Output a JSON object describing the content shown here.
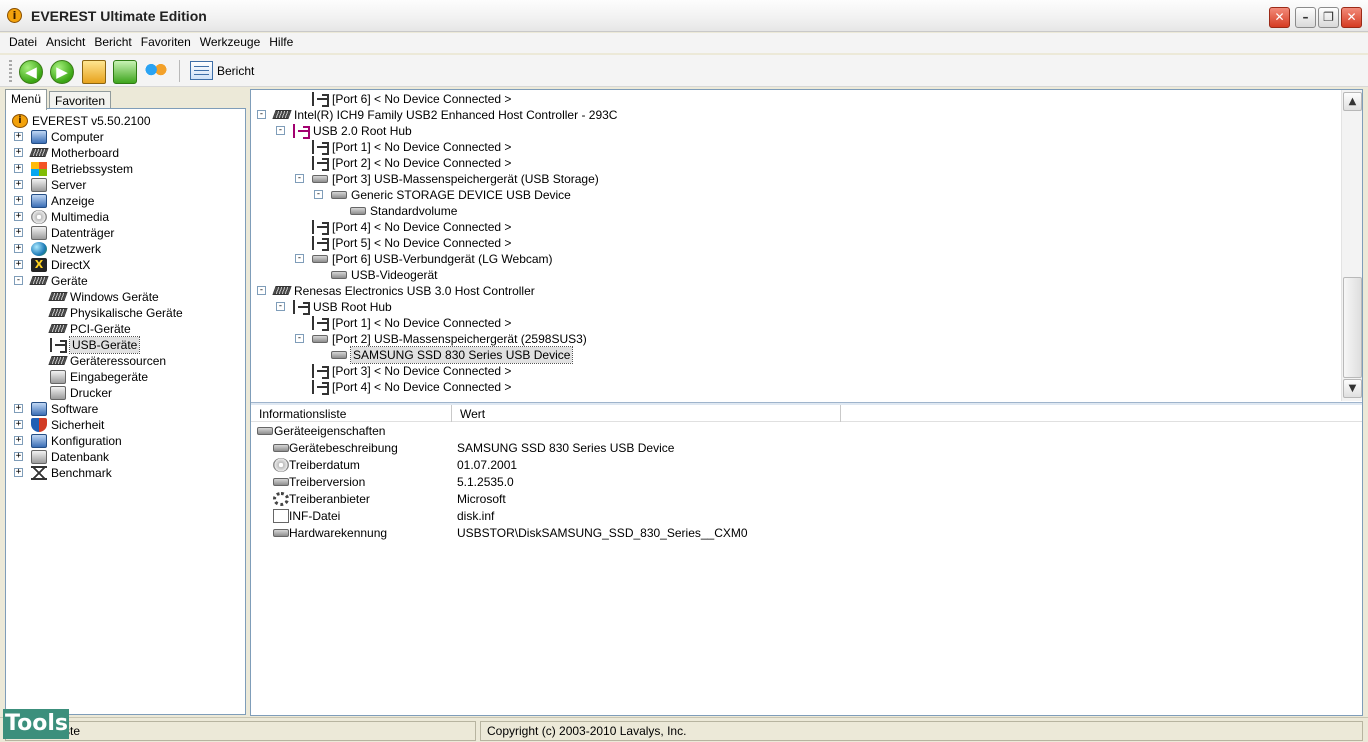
{
  "window": {
    "title": "EVEREST Ultimate Edition"
  },
  "menu": [
    "Datei",
    "Ansicht",
    "Bericht",
    "Favoriten",
    "Werkzeuge",
    "Hilfe"
  ],
  "toolbar": {
    "report_label": "Bericht"
  },
  "tabs": [
    "Menü",
    "Favoriten"
  ],
  "nav_tree": [
    {
      "label": "EVEREST v5.50.2100",
      "icon": "everest-icon",
      "level": 0
    },
    {
      "label": "Computer",
      "icon": "computer-icon",
      "level": 1,
      "expander": "+"
    },
    {
      "label": "Motherboard",
      "icon": "motherboard-icon",
      "level": 1,
      "expander": "+"
    },
    {
      "label": "Betriebssystem",
      "icon": "windows-icon",
      "level": 1,
      "expander": "+"
    },
    {
      "label": "Server",
      "icon": "server-icon",
      "level": 1,
      "expander": "+"
    },
    {
      "label": "Anzeige",
      "icon": "display-icon",
      "level": 1,
      "expander": "+"
    },
    {
      "label": "Multimedia",
      "icon": "multimedia-icon",
      "level": 1,
      "expander": "+"
    },
    {
      "label": "Datenträger",
      "icon": "storage-icon",
      "level": 1,
      "expander": "+"
    },
    {
      "label": "Netzwerk",
      "icon": "network-icon",
      "level": 1,
      "expander": "+"
    },
    {
      "label": "DirectX",
      "icon": "directx-icon",
      "level": 1,
      "expander": "+"
    },
    {
      "label": "Geräte",
      "icon": "devices-icon",
      "level": 1,
      "expander": "-"
    },
    {
      "label": "Windows Geräte",
      "icon": "device-icon",
      "level": 2
    },
    {
      "label": "Physikalische Geräte",
      "icon": "device-icon",
      "level": 2
    },
    {
      "label": "PCI-Geräte",
      "icon": "pci-icon",
      "level": 2
    },
    {
      "label": "USB-Geräte",
      "icon": "usb-icon",
      "level": 2,
      "selected": true
    },
    {
      "label": "Geräteressourcen",
      "icon": "device-icon",
      "level": 2
    },
    {
      "label": "Eingabegeräte",
      "icon": "mouse-icon",
      "level": 2
    },
    {
      "label": "Drucker",
      "icon": "printer-icon",
      "level": 2
    },
    {
      "label": "Software",
      "icon": "software-icon",
      "level": 1,
      "expander": "+"
    },
    {
      "label": "Sicherheit",
      "icon": "shield-icon",
      "level": 1,
      "expander": "+"
    },
    {
      "label": "Konfiguration",
      "icon": "config-icon",
      "level": 1,
      "expander": "+"
    },
    {
      "label": "Datenbank",
      "icon": "database-icon",
      "level": 1,
      "expander": "+"
    },
    {
      "label": "Benchmark",
      "icon": "hourglass-icon",
      "level": 1,
      "expander": "+"
    }
  ],
  "device_tree": [
    {
      "label": "[Port 6] < No Device Connected >",
      "icon": "usb-port-icon",
      "level": 3
    },
    {
      "label": "Intel(R) ICH9 Family USB2 Enhanced Host Controller - 293C",
      "icon": "controller-icon",
      "level": 1,
      "expander": "-"
    },
    {
      "label": "USB 2.0 Root Hub",
      "icon": "usb-hub-icon",
      "level": 2,
      "expander": "-"
    },
    {
      "label": "[Port 1] < No Device Connected >",
      "icon": "usb-port-icon",
      "level": 3
    },
    {
      "label": "[Port 2] < No Device Connected >",
      "icon": "usb-port-icon",
      "level": 3
    },
    {
      "label": "[Port 3] USB-Massenspeichergerät (USB Storage)",
      "icon": "drive-icon",
      "level": 3,
      "expander": "-"
    },
    {
      "label": "Generic STORAGE DEVICE USB Device",
      "icon": "drive-icon",
      "level": 4,
      "expander": "-"
    },
    {
      "label": "Standardvolume",
      "icon": "drive-icon",
      "level": 5
    },
    {
      "label": "[Port 4] < No Device Connected >",
      "icon": "usb-port-icon",
      "level": 3
    },
    {
      "label": "[Port 5] < No Device Connected >",
      "icon": "usb-port-icon",
      "level": 3
    },
    {
      "label": "[Port 6] USB-Verbundgerät (LG Webcam)",
      "icon": "drive-icon",
      "level": 3,
      "expander": "-"
    },
    {
      "label": "USB-Videogerät",
      "icon": "drive-icon",
      "level": 4
    },
    {
      "label": "Renesas Electronics USB 3.0 Host Controller",
      "icon": "controller-icon",
      "level": 1,
      "expander": "-"
    },
    {
      "label": "USB Root Hub",
      "icon": "usb-port-icon",
      "level": 2,
      "expander": "-"
    },
    {
      "label": "[Port 1] < No Device Connected >",
      "icon": "usb-port-icon",
      "level": 3
    },
    {
      "label": "[Port 2] USB-Massenspeichergerät (2598SUS3)",
      "icon": "drive-icon",
      "level": 3,
      "expander": "-"
    },
    {
      "label": "SAMSUNG SSD 830 Series USB Device",
      "icon": "drive-icon",
      "level": 4,
      "selected": true
    },
    {
      "label": "[Port 3] < No Device Connected >",
      "icon": "usb-port-icon",
      "level": 3
    },
    {
      "label": "[Port 4] < No Device Connected >",
      "icon": "usb-port-icon",
      "level": 3
    }
  ],
  "info_list": {
    "columns": [
      "Informationsliste",
      "Wert"
    ],
    "group": "Geräteeigenschaften",
    "rows": [
      {
        "label": "Gerätebeschreibung",
        "value": "SAMSUNG SSD 830 Series USB Device",
        "icon": "drive-icon"
      },
      {
        "label": "Treiberdatum",
        "value": "01.07.2001",
        "icon": "calendar-icon"
      },
      {
        "label": "Treiberversion",
        "value": "5.1.2535.0",
        "icon": "drive-icon"
      },
      {
        "label": "Treiberanbieter",
        "value": "Microsoft",
        "icon": "gears-icon"
      },
      {
        "label": "INF-Datei",
        "value": "disk.inf",
        "icon": "document-icon"
      },
      {
        "label": "Hardwarekennung",
        "value": "USBSTOR\\DiskSAMSUNG_SSD_830_Series__CXM0",
        "icon": "drive-icon"
      }
    ]
  },
  "status": {
    "left": "ste",
    "right": "Copyright (c) 2003-2010 Lavalys, Inc."
  },
  "watermark": "Tools"
}
